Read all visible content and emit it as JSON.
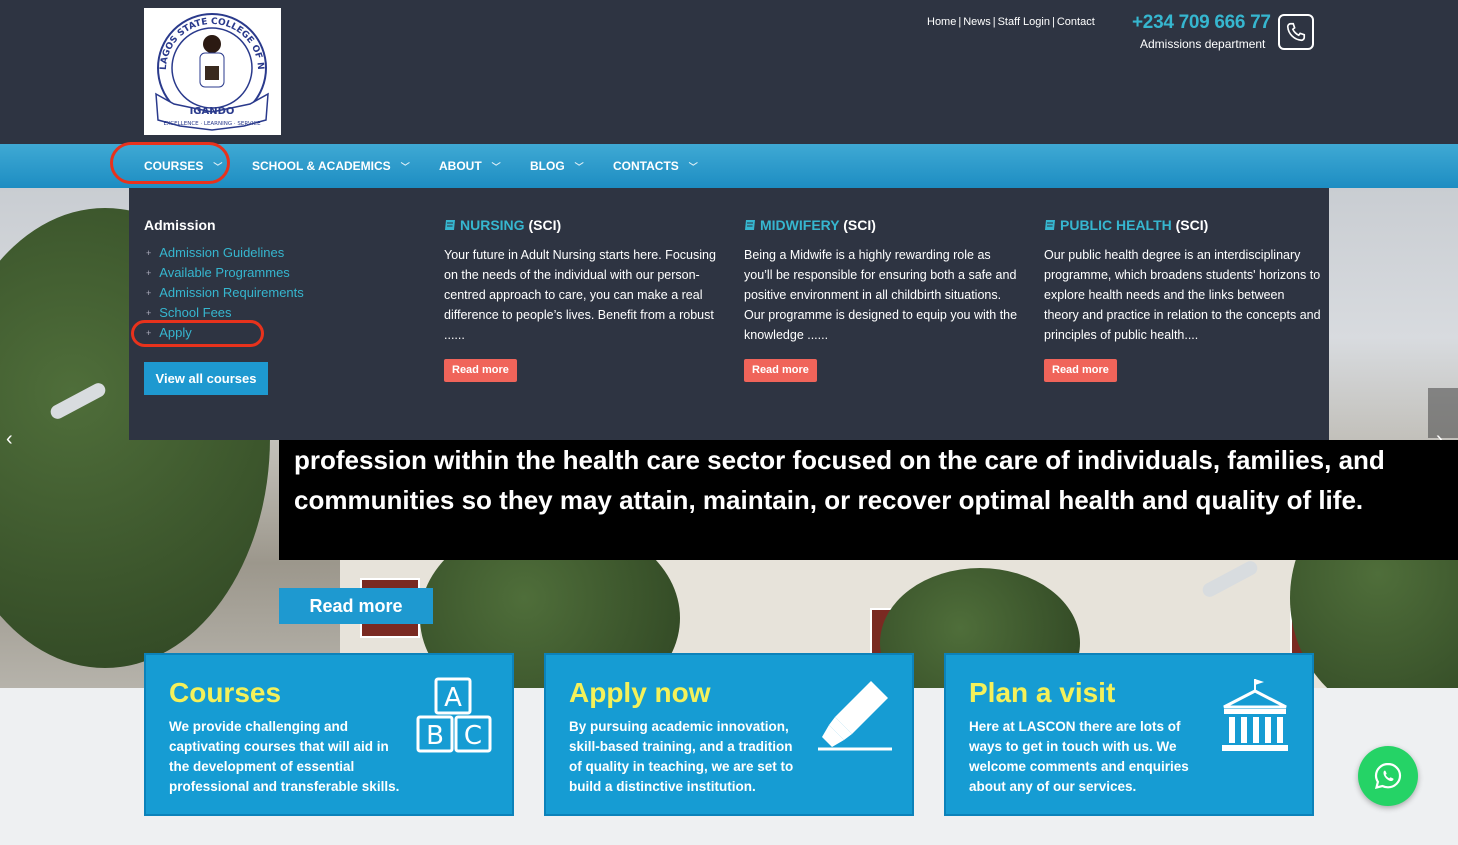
{
  "header": {
    "logo": {
      "ring_text": "LAGOS STATE COLLEGE OF NURSING",
      "banner_text": "IGANDO",
      "motto": "EXCELLENCE · LEARNING · SERVICE"
    },
    "top_links": [
      "Home",
      "News",
      "Staff Login",
      "Contact"
    ],
    "phone": "+234 709 666 77",
    "phone_sub": "Admissions department"
  },
  "nav": {
    "items": [
      "COURSES",
      "SCHOOL & ACADEMICS",
      "ABOUT",
      "BLOG",
      "CONTACTS"
    ]
  },
  "dropdown": {
    "admission_title": "Admission",
    "admission_links": [
      "Admission Guidelines",
      "Available Programmes",
      "Admission Requirements",
      "School Fees",
      "Apply"
    ],
    "view_all": "View all courses",
    "columns": [
      {
        "title": "NURSING",
        "suffix": "(SCI)",
        "text": "Your future in Adult Nursing starts here. Focusing on the needs of the individual with our person-centred approach to care, you can make a real difference to people’s lives. Benefit from a robust ......",
        "read_more": "Read more"
      },
      {
        "title": "MIDWIFERY",
        "suffix": "(SCI)",
        "text": "Being a Midwife is a highly rewarding role as you’ll be responsible for ensuring both a safe and positive environment in all childbirth situations. Our programme is designed to equip you with the knowledge ......",
        "read_more": "Read more"
      },
      {
        "title": "PUBLIC HEALTH",
        "suffix": "(SCI)",
        "text": "Our public health degree is an interdisciplinary programme, which broadens students' horizons to explore health needs and the links between theory and practice in relation to the concepts and principles of public health....",
        "read_more": "Read more"
      }
    ]
  },
  "hero": {
    "caption": "profession within the health care sector focused on the care of individuals, families, and communities so they may attain, maintain, or recover optimal health and quality of life.",
    "read_more": "Read more"
  },
  "cards": [
    {
      "title": "Courses",
      "text": "We provide challenging and captivating courses that will aid in the development of essential professional and transferable skills.",
      "icon": "abc-blocks-icon",
      "icon_letters": [
        "A",
        "B",
        "C"
      ]
    },
    {
      "title": "Apply now",
      "text": "By pursuing academic innovation, skill-based training, and a tradition of quality in teaching, we are set to build a distinctive institution.",
      "icon": "highlighter-icon"
    },
    {
      "title": "Plan a visit",
      "text": "Here at LASCON there are lots of ways to get in touch with us. We welcome comments and enquiries about any of our services.",
      "icon": "institution-icon"
    }
  ],
  "colors": {
    "header_bg": "#2e3442",
    "nav_blue": "#1d8dc2",
    "link_cyan": "#36b6cf",
    "card_blue": "#169cd3",
    "card_title_yellow": "#f4f15a",
    "read_more_red": "#f0645a",
    "highlight_red": "#e8321c",
    "whatsapp_green": "#25d366"
  }
}
